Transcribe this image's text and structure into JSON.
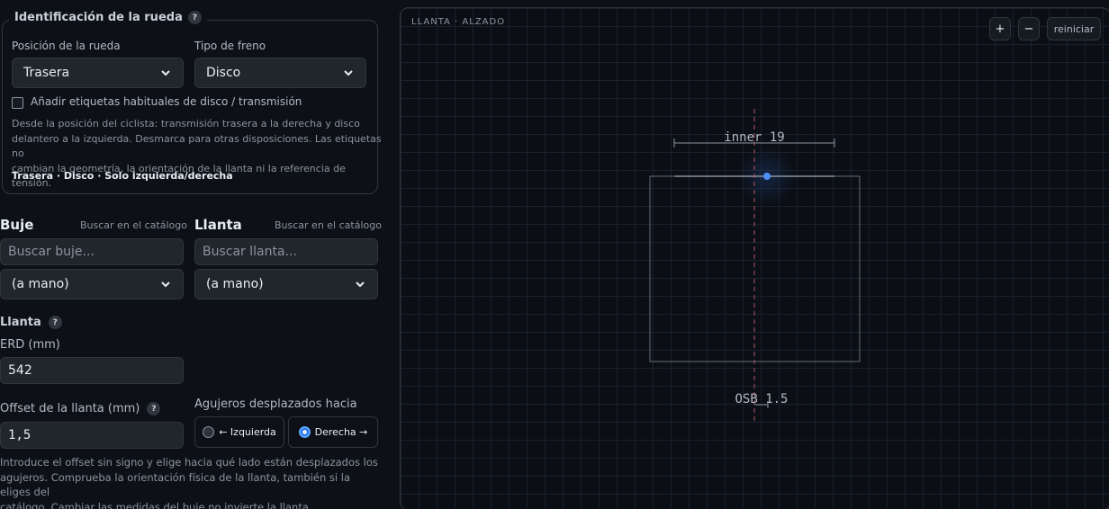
{
  "wheel_id": {
    "title": "Identificación de la rueda",
    "help": "?",
    "position_label": "Posición de la rueda",
    "position_value": "Trasera",
    "brake_label": "Tipo de freno",
    "brake_value": "Disco",
    "checkbox_label": "Añadir etiquetas habituales de disco / transmisión",
    "checkbox_checked": false,
    "desc_line1": "Desde la posición del ciclista: transmisión trasera a la derecha y disco",
    "desc_line2": "delantero a la izquierda. Desmarca para otras disposiciones. Las etiquetas no",
    "desc_line3": "cambian la geometría, la orientación de la llanta ni la referencia de tensión.",
    "summary": "Trasera · Disco · Solo izquierda/derecha"
  },
  "hub": {
    "title": "Buje",
    "catalog_link": "Buscar en el catálogo",
    "search_placeholder": "Buscar buje...",
    "select_value": "(a mano)"
  },
  "rim_pick": {
    "title": "Llanta",
    "catalog_link": "Buscar en el catálogo",
    "search_placeholder": "Buscar llanta...",
    "select_value": "(a mano)"
  },
  "rim": {
    "title": "Llanta",
    "help": "?",
    "erd_label": "ERD (mm)",
    "erd_value": "542",
    "offset_label": "Offset de la llanta (mm)",
    "offset_help": "?",
    "offset_value": "1,5",
    "holes_label": "Agujeros desplazados hacia",
    "left_option": "← Izquierda",
    "right_option": "Derecha →",
    "selected": "right",
    "note_line1": "Introduce el offset sin signo y elige hacia qué lado están desplazados los",
    "note_line2": "agujeros. Comprueba la orientación física de la llanta, también si la eliges del",
    "note_line3": "catálogo. Cambiar las medidas del buje no invierte la llanta."
  },
  "canvas": {
    "view_label": "LLANTA · ALZADO",
    "zoom_in": "+",
    "zoom_out": "−",
    "reset": "reiniciar",
    "inner_label": "inner 19",
    "osb_label": "OSB 1.5",
    "colors": {
      "marker": "#4f8ff7",
      "centerline": "#b0505a",
      "outline": "#8b949e"
    }
  }
}
